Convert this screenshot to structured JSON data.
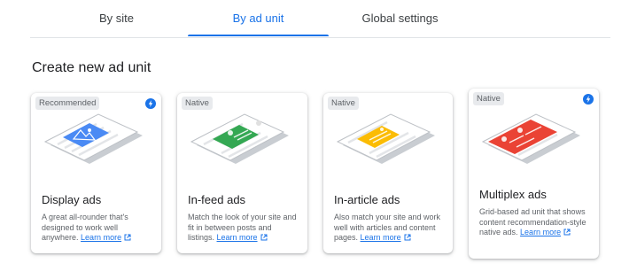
{
  "tabs": [
    {
      "label": "By site",
      "active": false
    },
    {
      "label": "By ad unit",
      "active": true
    },
    {
      "label": "Global settings",
      "active": false
    }
  ],
  "section_title": "Create new ad unit",
  "cards": [
    {
      "badge": "Recommended",
      "title": "Display ads",
      "desc": "A great all-rounder that's designed to work well anywhere.",
      "link": "Learn more",
      "accent": "#4a8af4",
      "bolt": true
    },
    {
      "badge": "Native",
      "title": "In-feed ads",
      "desc": "Match the look of your site and fit in between posts and listings.",
      "link": "Learn more",
      "accent": "#34a853",
      "bolt": false
    },
    {
      "badge": "Native",
      "title": "In-article ads",
      "desc": "Also match your site and work well with articles and content pages.",
      "link": "Learn more",
      "accent": "#fbbc04",
      "bolt": false
    },
    {
      "badge": "Native",
      "title": "Multiplex ads",
      "desc": "Grid-based ad unit that shows content recommendation-style native ads.",
      "link": "Learn more",
      "accent": "#ea4335",
      "bolt": true
    }
  ],
  "colors": {
    "brand": "#1a73e8",
    "badge_bg": "#e8eaed"
  },
  "icons": {
    "bolt": "lightning-bolt-icon",
    "external": "open-in-new-icon"
  }
}
